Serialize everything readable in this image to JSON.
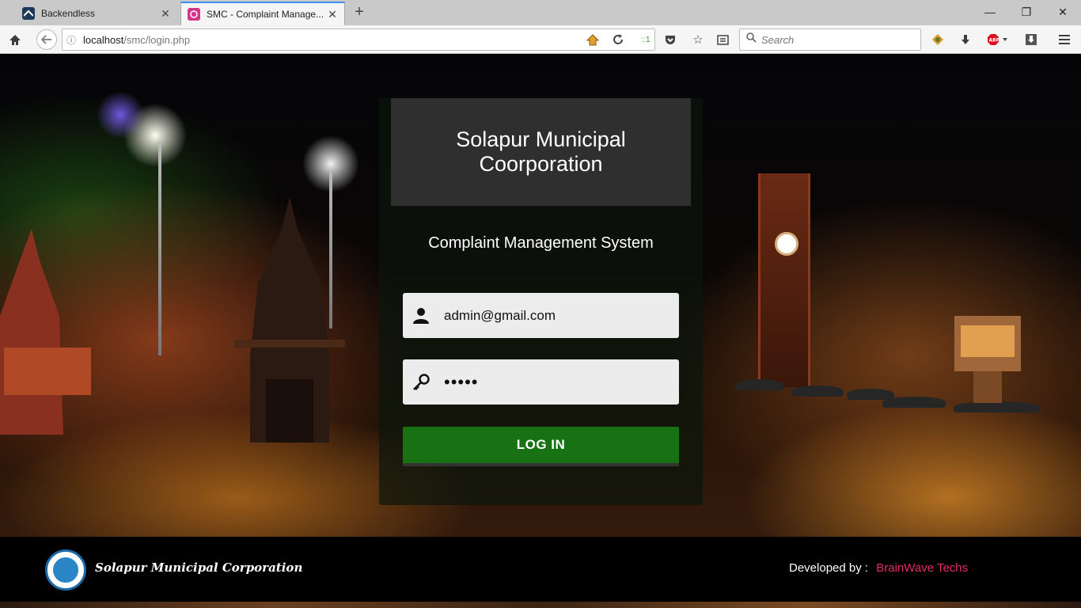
{
  "browser": {
    "tabs": [
      {
        "title": "Backendless",
        "active": false,
        "icon": "backendless-icon"
      },
      {
        "title": "SMC - Complaint Manage...",
        "active": true,
        "icon": "smc-favicon"
      }
    ],
    "url_host": "localhost",
    "url_path": "/smc/login.php",
    "zoom_indicator": "::1",
    "search_placeholder": "Search",
    "new_tab_symbol": "+"
  },
  "page": {
    "header_title": "Solapur Municipal Coorporation",
    "subtitle": "Complaint Management System",
    "email_value": "admin@gmail.com",
    "password_value": "•••••",
    "login_button": "LOG IN"
  },
  "footer": {
    "org_name": "Solapur Municipal Corporation",
    "developed_by_label": "Developed by :",
    "developer_name": "BrainWave Techs"
  },
  "colors": {
    "login_button": "#187214",
    "card_header": "#2f2f2f",
    "developer_link": "#e52b66",
    "active_tab_accent": "#3a8ff1"
  }
}
